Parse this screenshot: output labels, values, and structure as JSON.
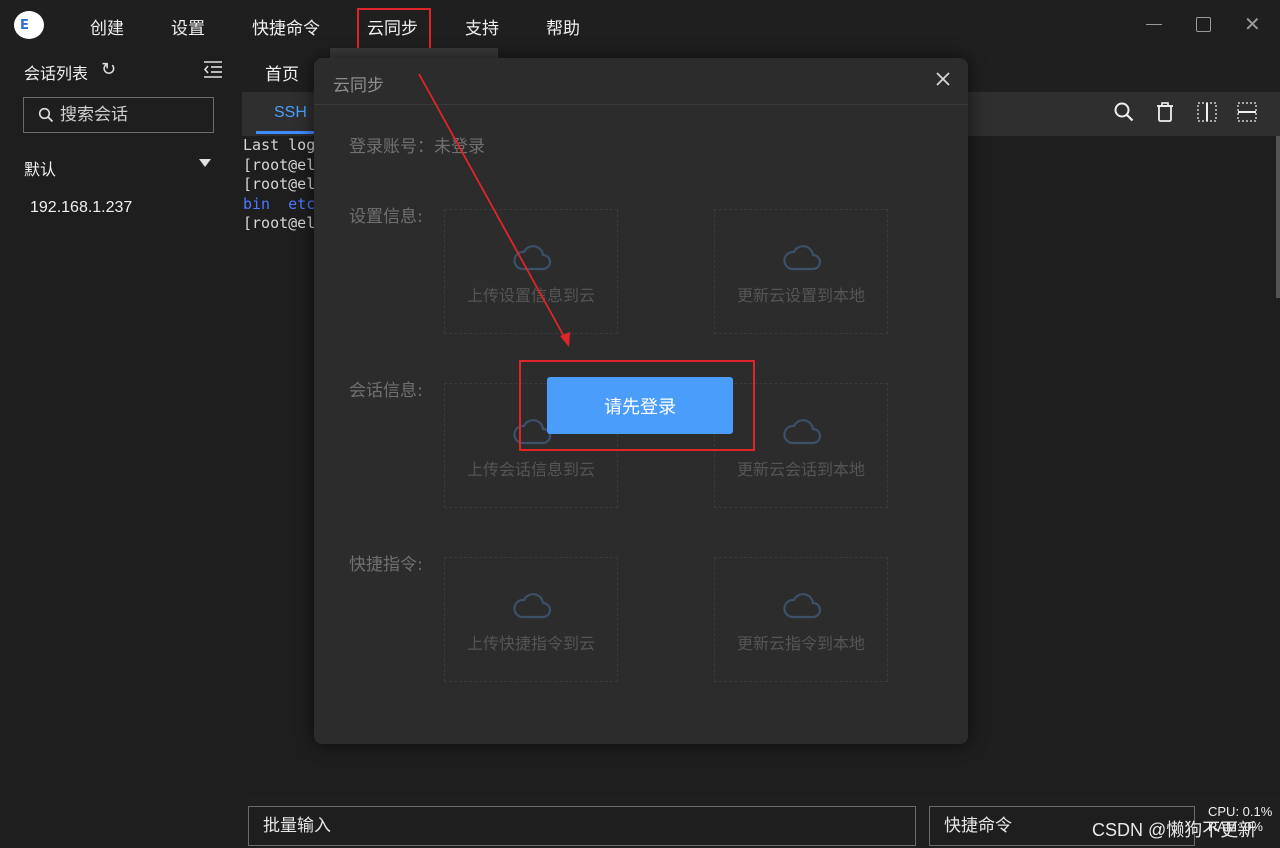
{
  "menubar": {
    "logo_text": "E",
    "items": [
      "创建",
      "设置",
      "快捷命令",
      "云同步",
      "支持",
      "帮助"
    ]
  },
  "window_controls": {
    "close": "✕"
  },
  "sidebar": {
    "title": "会话列表",
    "refresh_icon": "↻",
    "search_placeholder": "搜索会话",
    "group": "默认",
    "hosts": [
      "192.168.1.237"
    ]
  },
  "tabs": {
    "home": "首页",
    "ssh": "SSH"
  },
  "terminal": {
    "lines": [
      "Last log",
      "[root@el",
      "[root@el",
      "bin  etc",
      "[root@el"
    ]
  },
  "bottom": {
    "bulk_placeholder": "批量输入",
    "quick_placeholder": "快捷命令",
    "cpu": "CPU: 0.1%",
    "ram": "RAM: 0%",
    "watermark": "CSDN @懒狗不更新"
  },
  "dialog": {
    "title": "云同步",
    "account": "登录账号：未登录",
    "settings_label": "设置信息:",
    "sessions_label": "会话信息:",
    "commands_label": "快捷指令:",
    "cards": {
      "upload_settings": "上传设置信息到云",
      "update_settings": "更新云设置到本地",
      "upload_sessions": "上传会话信息到云",
      "update_sessions": "更新云会话到本地",
      "upload_commands": "上传快捷指令到云",
      "update_commands": "更新云指令到本地"
    },
    "login_button": "请先登录"
  },
  "colors": {
    "accent": "#4a9dfb",
    "highlight": "#e0252a",
    "background": "#1f1f1f"
  }
}
